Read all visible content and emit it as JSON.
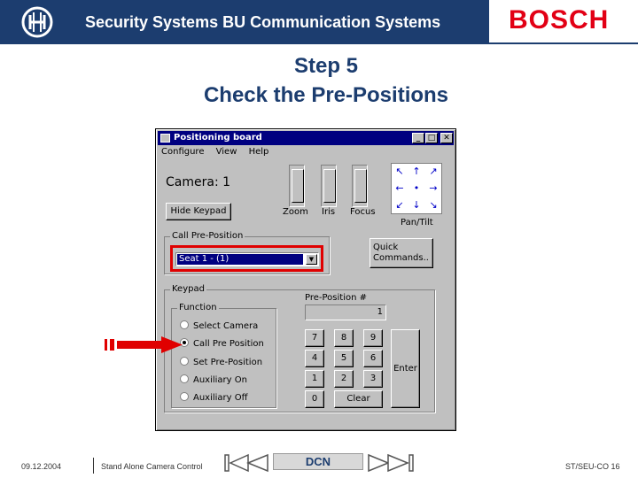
{
  "header": {
    "bar_title": "Security Systems BU Communication Systems",
    "logo_text": "BOSCH",
    "colors": {
      "navy": "#1c3d6f",
      "brand_red": "#e20015"
    }
  },
  "slide": {
    "title_line1": "Step 5",
    "title_line2": "Check the Pre-Positions"
  },
  "window": {
    "title": "Positioning board",
    "controls": {
      "minimize": "_",
      "maximize": "□",
      "close": "✕"
    },
    "menu": [
      "Configure",
      "View",
      "Help"
    ],
    "camera_label": "Camera: 1",
    "hide_keypad": "Hide Keypad",
    "sliders": {
      "zoom": "Zoom",
      "iris": "Iris",
      "focus": "Focus"
    },
    "pan_tilt_label": "Pan/Tilt",
    "call_preposition": {
      "group_label": "Call Pre-Position",
      "selected": "Seat 1 - (1)",
      "arrow": "▼"
    },
    "quick_commands": "Quick Commands..",
    "keypad": {
      "group_label": "Keypad",
      "function_label": "Function",
      "functions": [
        {
          "label": "Select Camera",
          "selected": false
        },
        {
          "label": "Call Pre Position",
          "selected": true
        },
        {
          "label": "Set Pre-Position",
          "selected": false
        },
        {
          "label": "Auxiliary On",
          "selected": false
        },
        {
          "label": "Auxiliary Off",
          "selected": false
        }
      ],
      "preposition_label": "Pre-Position #",
      "preposition_value": "1",
      "keys": [
        "7",
        "8",
        "9",
        "4",
        "5",
        "6",
        "1",
        "2",
        "3",
        "0"
      ],
      "clear": "Clear",
      "enter": "Enter"
    }
  },
  "footer": {
    "date": "09.12.2004",
    "description": "Stand Alone Camera Control",
    "nav_label": "DCN",
    "code": "ST/SEU-CO 16"
  }
}
